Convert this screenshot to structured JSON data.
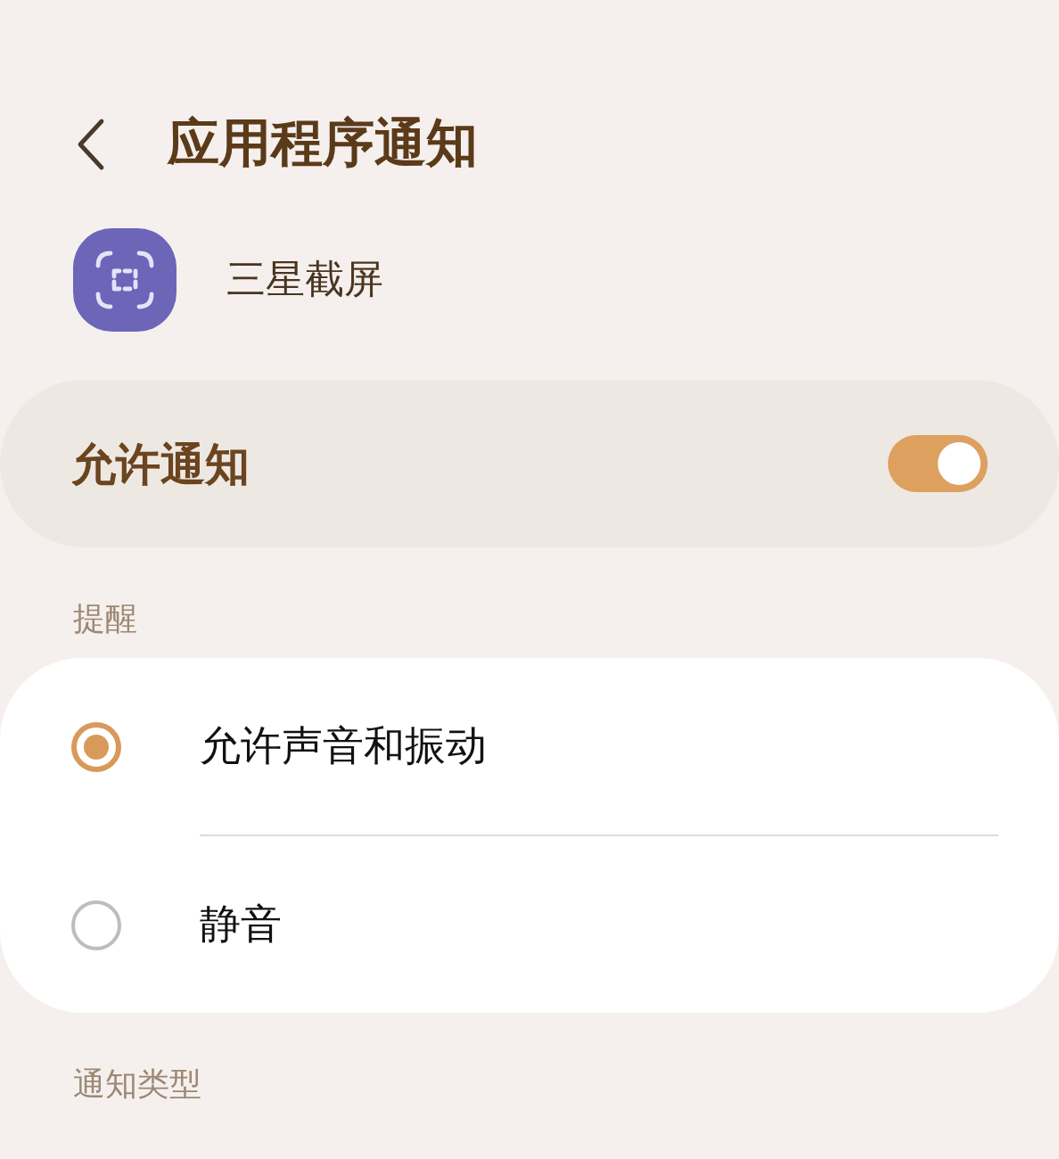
{
  "header": {
    "title": "应用程序通知"
  },
  "app": {
    "name": "三星截屏"
  },
  "master": {
    "label": "允许通知",
    "on": true
  },
  "sections": [
    {
      "title": "提醒",
      "options": [
        {
          "label": "允许声音和振动",
          "selected": true
        },
        {
          "label": "静音",
          "selected": false
        }
      ]
    },
    {
      "title": "通知类型"
    }
  ]
}
